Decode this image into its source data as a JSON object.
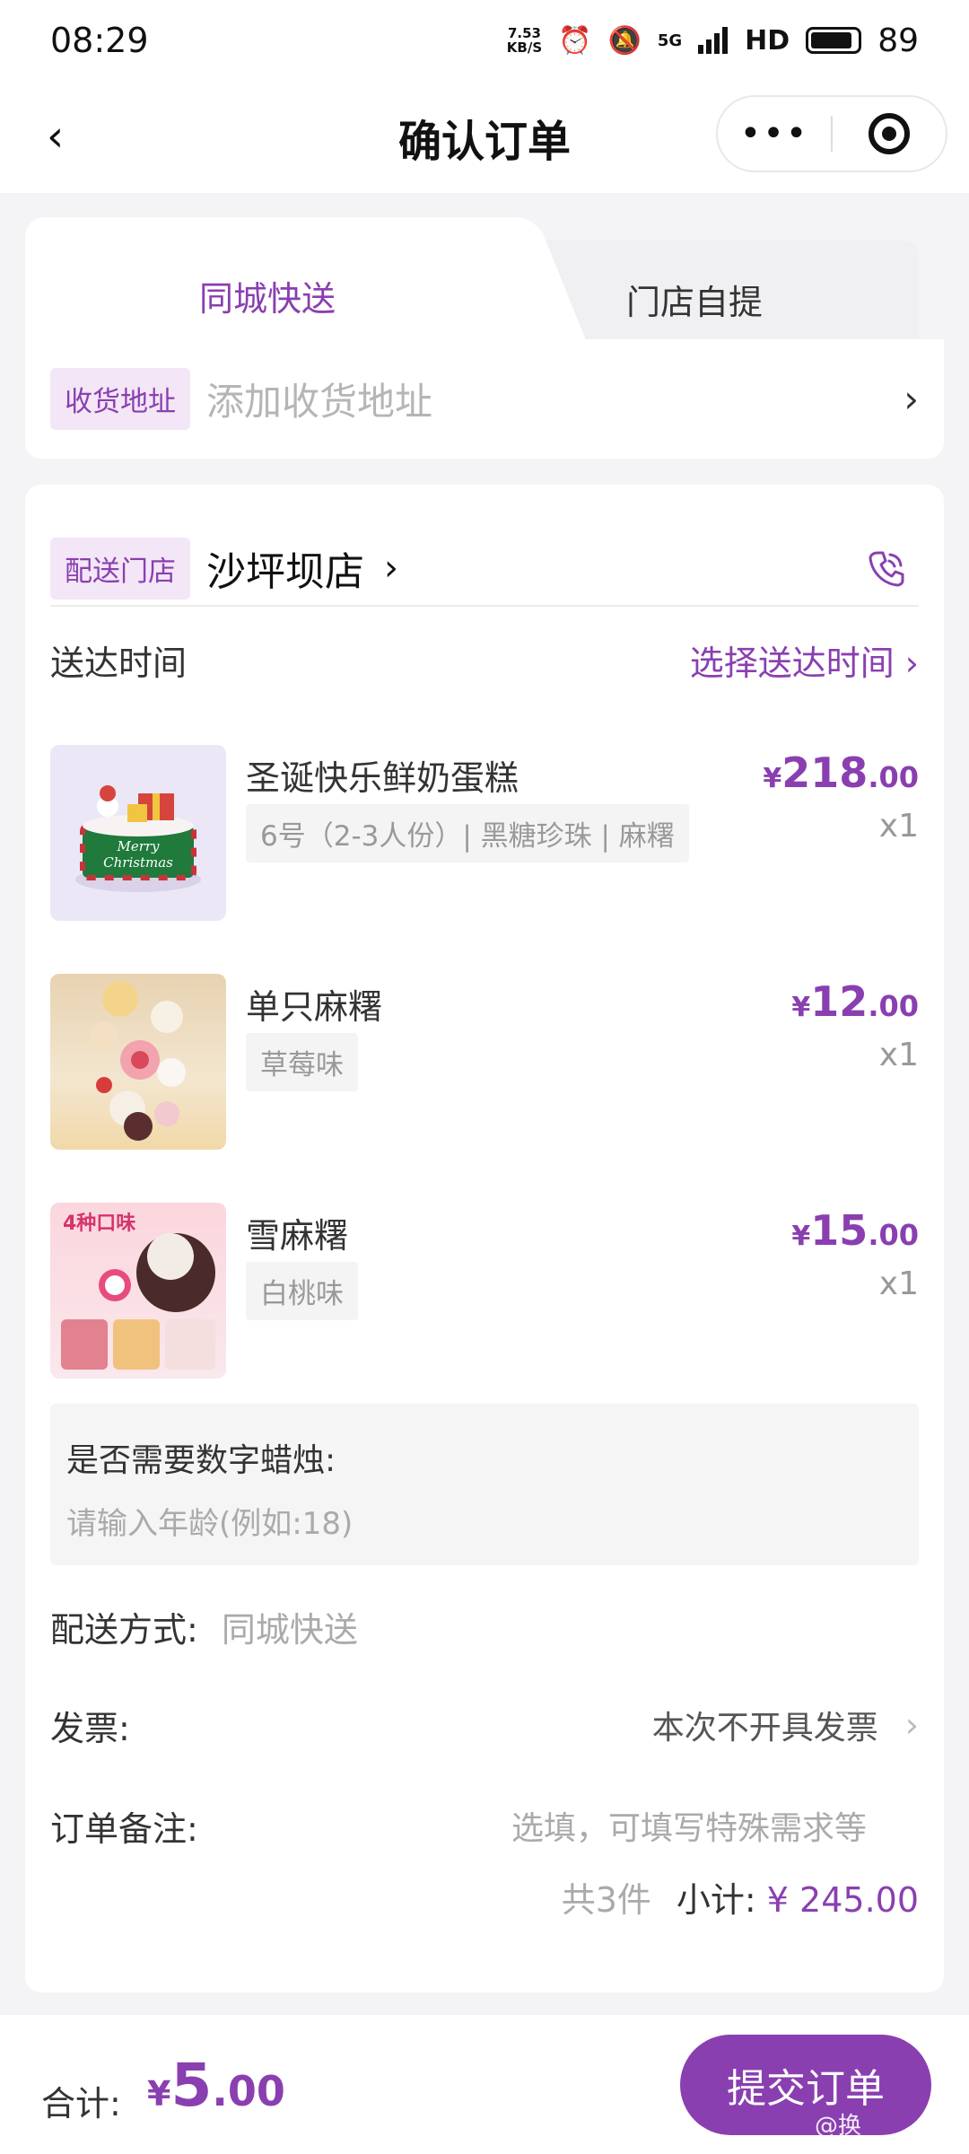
{
  "status": {
    "time": "08:29",
    "net_speed_top": "7.53",
    "net_speed_bottom": "KB/S",
    "signal": "5G",
    "hd": "HD",
    "battery": "89",
    "battery_level": 0.89
  },
  "nav": {
    "title": "确认订单",
    "back": "‹",
    "more": "•••"
  },
  "tabs": [
    {
      "label": "同城快送",
      "active": true
    },
    {
      "label": "门店自提",
      "active": false
    }
  ],
  "address": {
    "tag": "收货地址",
    "placeholder": "添加收货地址"
  },
  "store": {
    "tag": "配送门店",
    "name": "沙坪坝店",
    "arrow": "›"
  },
  "delivery_time": {
    "label": "送达时间",
    "action": "选择送达时间 ›"
  },
  "products": [
    {
      "name": "圣诞快乐鲜奶蛋糕",
      "spec": "6号（2-3人份）| 黑糖珍珠 | 麻糬",
      "price_currency": "¥",
      "price_int": "218",
      "price_dec": ".00",
      "qty": "x1"
    },
    {
      "name": "单只麻糬",
      "spec": "草莓味",
      "price_currency": "¥",
      "price_int": "12",
      "price_dec": ".00",
      "qty": "x1"
    },
    {
      "name": "雪麻糬",
      "spec": "白桃味",
      "price_currency": "¥",
      "price_int": "15",
      "price_dec": ".00",
      "qty": "x1"
    }
  ],
  "thumb_texts": {
    "cake_line1": "Merry",
    "cake_line2": "Christmas",
    "mochi_badge": "4种口味"
  },
  "candle": {
    "question": "是否需要数字蜡烛:",
    "placeholder": "请输入年龄(例如:18)"
  },
  "shipping": {
    "label": "配送方式:",
    "value": "同城快送"
  },
  "invoice": {
    "label": "发票:",
    "value": "本次不开具发票"
  },
  "remark": {
    "label": "订单备注:",
    "placeholder": "选填，可填写特殊需求等"
  },
  "subtotal": {
    "count": "共3件",
    "label": "小计:",
    "amount": "¥ 245.00"
  },
  "footer": {
    "total_label": "合计:",
    "total_currency": "¥",
    "total_int": "5",
    "total_dec": ".00",
    "submit": "提交订单",
    "watermark": "@换"
  },
  "colors": {
    "accent": "#8a3fb0",
    "tag_bg": "#f3e6f6",
    "background": "#f4f4f6"
  }
}
